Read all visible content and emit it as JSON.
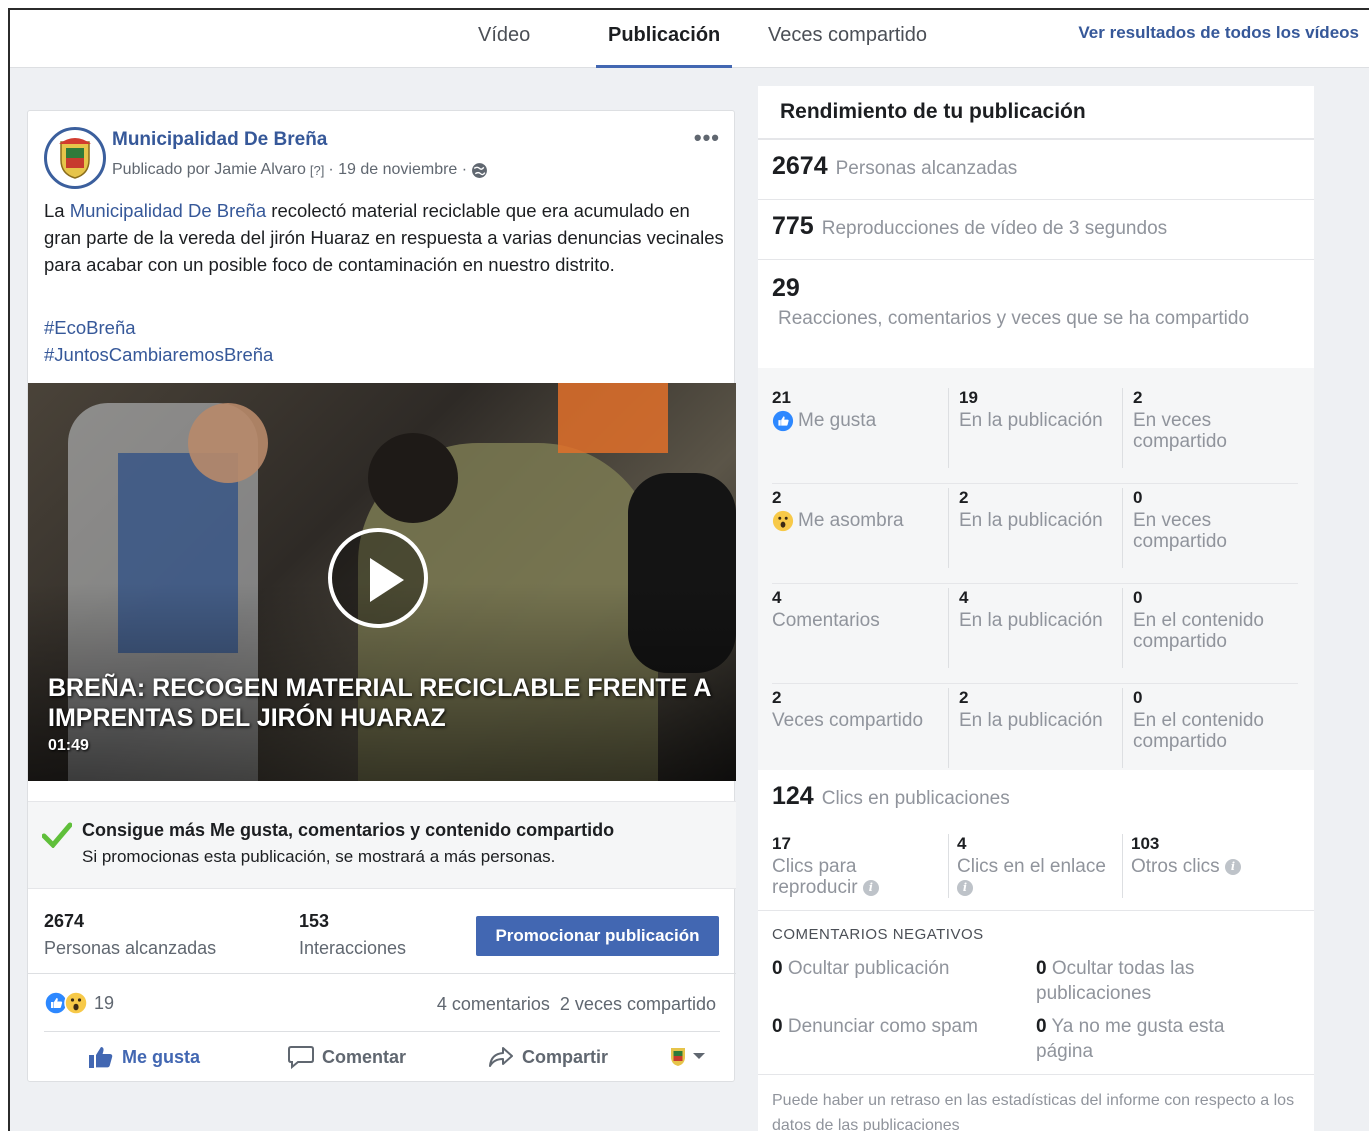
{
  "tabs": {
    "video": "Vídeo",
    "publication": "Publicación",
    "shares": "Veces compartido",
    "view_all": "Ver resultados de todos los vídeos"
  },
  "post": {
    "page_name": "Municipalidad De Breña",
    "published_by": "Publicado por Jamie Alvaro",
    "help_marker": "[?]",
    "date": "· 19 de noviembre ·",
    "text_pre": "La ",
    "text_link": "Municipalidad De Breña",
    "text_post": " recolectó material reciclable que era acumulado en gran parte de la vereda del jirón Huaraz en respuesta a varias denuncias vecinales para acabar con un posible foco de contaminación en nuestro distrito.",
    "hashtags": [
      "#EcoBreña",
      "#JuntosCambiaremosBreña"
    ],
    "video_title": "BREÑA: RECOGEN MATERIAL RECICLABLE FRENTE A IMPRENTAS DEL JIRÓN HUARAZ",
    "video_duration": "01:49",
    "promo_title": "Consigue más Me gusta, comentarios y contenido compartido",
    "promo_sub": "Si promocionas esta publicación, se mostrará a más personas.",
    "reach_value": "2674",
    "reach_label": "Personas alcanzadas",
    "interactions_value": "153",
    "interactions_label": "Interacciones",
    "promote_button": "Promocionar publicación",
    "reactions_count": "19",
    "comments_shares": "4 comentarios  2 veces compartido",
    "action_like": "Me gusta",
    "action_comment": "Comentar",
    "action_share": "Compartir"
  },
  "performance": {
    "title": "Rendimiento de tu publicación",
    "reach": {
      "value": "2674",
      "label": "Personas alcanzadas"
    },
    "plays": {
      "value": "775",
      "label": "Reproducciones de vídeo de 3 segundos"
    },
    "engagement": {
      "value": "29",
      "label": "Reacciones, comentarios y veces que se ha compartido"
    },
    "breakdown": [
      {
        "total": "21",
        "label": "Me gusta",
        "on_post": "19",
        "on_post_label": "En la publicación",
        "other": "2",
        "other_label": "En veces compartido"
      },
      {
        "total": "2",
        "label": "Me asombra",
        "on_post": "2",
        "on_post_label": "En la publicación",
        "other": "0",
        "other_label": "En veces compartido"
      },
      {
        "total": "4",
        "label": "Comentarios",
        "on_post": "4",
        "on_post_label": "En la publicación",
        "other": "0",
        "other_label": "En el contenido compartido"
      },
      {
        "total": "2",
        "label": "Veces compartido",
        "on_post": "2",
        "on_post_label": "En la publicación",
        "other": "0",
        "other_label": "En el contenido compartido"
      }
    ],
    "clicks": {
      "value": "124",
      "label": "Clics en publicaciones"
    },
    "click_breakdown": [
      {
        "value": "17",
        "label": "Clics para reproducir"
      },
      {
        "value": "4",
        "label": "Clics en el enlace"
      },
      {
        "value": "103",
        "label": "Otros clics"
      }
    ],
    "negative_title": "COMENTARIOS NEGATIVOS",
    "negative": [
      {
        "value": "0",
        "label": "Ocultar publicación"
      },
      {
        "value": "0",
        "label": "Ocultar todas las publicaciones"
      },
      {
        "value": "0",
        "label": "Denunciar como spam"
      },
      {
        "value": "0",
        "label": "Ya no me gusta esta página"
      }
    ],
    "footnote": "Puede haber un retraso en las estadísticas del informe con respecto a los datos de las publicaciones"
  },
  "colors": {
    "accent": "#4267b2",
    "link": "#365899",
    "muted": "#90949c"
  }
}
